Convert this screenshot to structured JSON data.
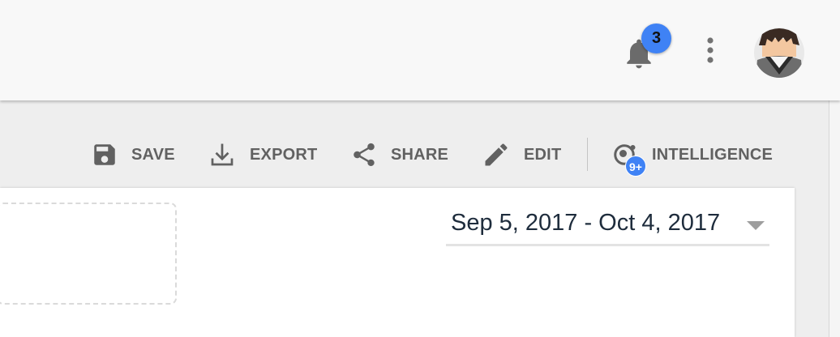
{
  "header": {
    "notifications": {
      "count": "3",
      "icon": "bell-icon"
    },
    "menu_icon": "more-vert-icon",
    "avatar_icon": "user-avatar"
  },
  "toolbar": {
    "save_label": "SAVE",
    "export_label": "EXPORT",
    "share_label": "SHARE",
    "edit_label": "EDIT",
    "intelligence_label": "INTELLIGENCE",
    "intelligence_badge": "9+"
  },
  "report": {
    "date_range": "Sep 5, 2017 - Oct 4, 2017"
  },
  "colors": {
    "accent": "#3f82f5",
    "icon_grey": "#616161",
    "date_text": "#1e2c3c"
  }
}
